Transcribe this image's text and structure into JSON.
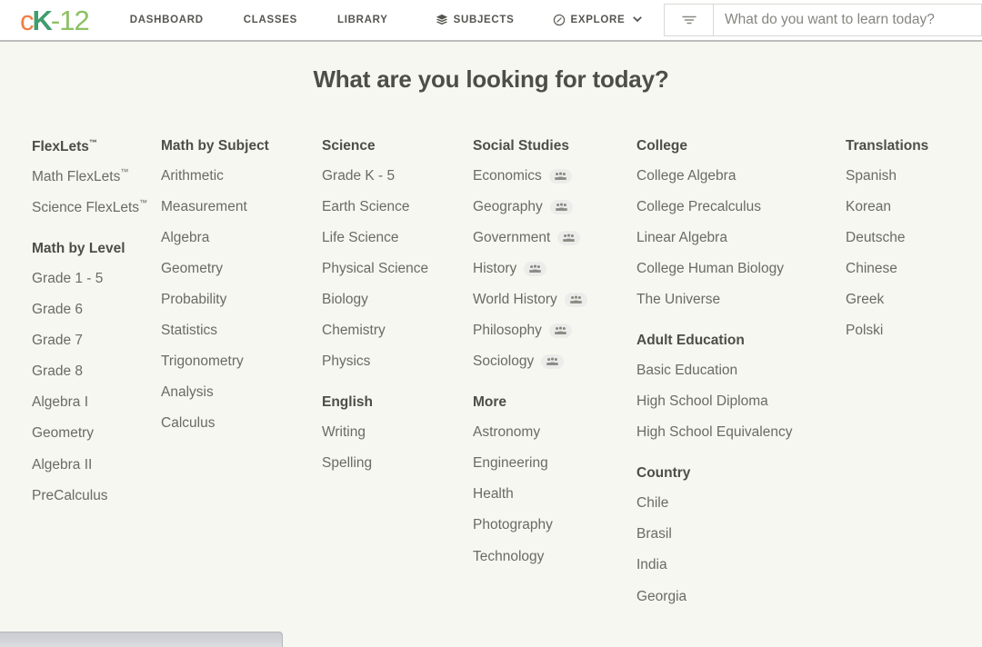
{
  "header": {
    "logo": {
      "c": "c",
      "k": "K",
      "n": "-12"
    },
    "nav": [
      {
        "id": "dashboard",
        "label": "DASHBOARD",
        "icon": null
      },
      {
        "id": "classes",
        "label": "CLASSES",
        "icon": null
      },
      {
        "id": "library",
        "label": "LIBRARY",
        "icon": null
      },
      {
        "id": "subjects",
        "label": "SUBJECTS",
        "icon": "layers-icon"
      },
      {
        "id": "explore",
        "label": "EXPLORE",
        "icon": "compass-icon",
        "caret": "chevron-down-icon"
      }
    ],
    "search": {
      "filter_icon": "filter-icon",
      "placeholder": "What do you want to learn today?",
      "value": ""
    }
  },
  "main": {
    "title": "What are you looking for today?",
    "columns": [
      {
        "groups": [
          {
            "title": "FlexLets",
            "title_tm": "™",
            "items": [
              {
                "label": "Math FlexLets",
                "tm": "™"
              },
              {
                "label": "Science FlexLets",
                "tm": "™"
              }
            ]
          },
          {
            "title": "Math by Level",
            "items": [
              {
                "label": "Grade 1 - 5"
              },
              {
                "label": "Grade 6"
              },
              {
                "label": "Grade 7"
              },
              {
                "label": "Grade 8"
              },
              {
                "label": "Algebra I"
              },
              {
                "label": "Geometry"
              },
              {
                "label": "Algebra II"
              },
              {
                "label": "PreCalculus"
              }
            ]
          }
        ]
      },
      {
        "groups": [
          {
            "title": "Math by Subject",
            "items": [
              {
                "label": "Arithmetic"
              },
              {
                "label": "Measurement"
              },
              {
                "label": "Algebra"
              },
              {
                "label": "Geometry"
              },
              {
                "label": "Probability"
              },
              {
                "label": "Statistics"
              },
              {
                "label": "Trigonometry"
              },
              {
                "label": "Analysis"
              },
              {
                "label": "Calculus"
              }
            ]
          }
        ]
      },
      {
        "groups": [
          {
            "title": "Science",
            "items": [
              {
                "label": "Grade K - 5"
              },
              {
                "label": "Earth Science"
              },
              {
                "label": "Life Science"
              },
              {
                "label": "Physical Science"
              },
              {
                "label": "Biology"
              },
              {
                "label": "Chemistry"
              },
              {
                "label": "Physics"
              }
            ]
          },
          {
            "title": "English",
            "items": [
              {
                "label": "Writing"
              },
              {
                "label": "Spelling"
              }
            ]
          }
        ]
      },
      {
        "groups": [
          {
            "title": "Social Studies",
            "items": [
              {
                "label": "Economics",
                "badge": "community-icon"
              },
              {
                "label": "Geography",
                "badge": "community-icon"
              },
              {
                "label": "Government",
                "badge": "community-icon"
              },
              {
                "label": "History",
                "badge": "community-icon"
              },
              {
                "label": "World History",
                "badge": "community-icon"
              },
              {
                "label": "Philosophy",
                "badge": "community-icon"
              },
              {
                "label": "Sociology",
                "badge": "community-icon"
              }
            ]
          },
          {
            "title": "More",
            "items": [
              {
                "label": "Astronomy"
              },
              {
                "label": "Engineering"
              },
              {
                "label": "Health"
              },
              {
                "label": "Photography"
              },
              {
                "label": "Technology"
              }
            ]
          }
        ]
      },
      {
        "groups": [
          {
            "title": "College",
            "items": [
              {
                "label": "College Algebra"
              },
              {
                "label": "College Precalculus"
              },
              {
                "label": "Linear Algebra"
              },
              {
                "label": "College Human Biology"
              },
              {
                "label": "The Universe"
              }
            ]
          },
          {
            "title": "Adult Education",
            "items": [
              {
                "label": "Basic Education"
              },
              {
                "label": "High School Diploma"
              },
              {
                "label": "High School Equivalency"
              }
            ]
          },
          {
            "title": "Country",
            "items": [
              {
                "label": "Chile"
              },
              {
                "label": "Brasil"
              },
              {
                "label": "India"
              },
              {
                "label": "Georgia"
              }
            ]
          }
        ]
      },
      {
        "groups": [
          {
            "title": "Translations",
            "items": [
              {
                "label": "Spanish"
              },
              {
                "label": "Korean"
              },
              {
                "label": "Deutsche"
              },
              {
                "label": "Chinese"
              },
              {
                "label": "Greek"
              },
              {
                "label": "Polski"
              }
            ]
          }
        ]
      }
    ]
  },
  "download_bar": {
    "visible": true
  },
  "colors": {
    "logo_orange": "#ef7e43",
    "logo_green_dark": "#3f9d6e",
    "logo_green_light": "#8cc163",
    "page_background": "#f7f7f2",
    "header_background": "#ffffff",
    "heading_text": "#4e4e48",
    "item_text": "#6b6b64",
    "badge_background": "#ececea"
  }
}
